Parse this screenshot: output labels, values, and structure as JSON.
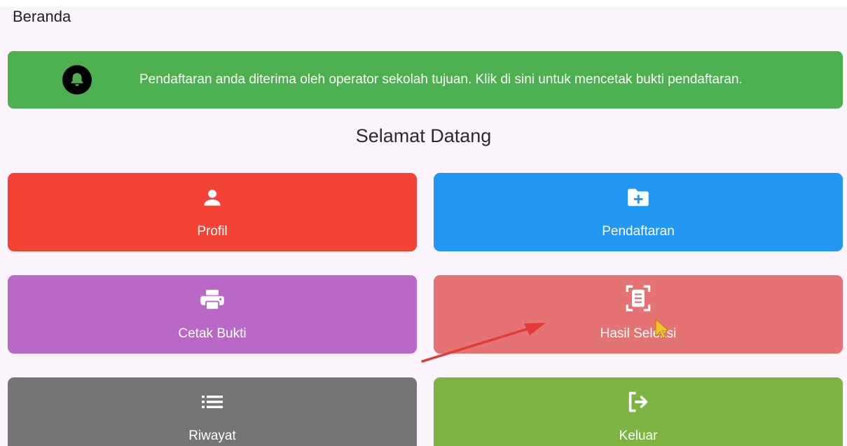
{
  "header": {
    "title": "Beranda"
  },
  "notification": {
    "text": "Pendaftaran anda diterima oleh operator sekolah tujuan. Klik di sini untuk mencetak bukti pendaftaran.",
    "icon": "bell-icon",
    "color": "#4caf50"
  },
  "welcome": {
    "text": "Selamat Datang"
  },
  "menu": {
    "tiles": [
      {
        "label": "Profil",
        "icon": "user-icon",
        "color": "#f44336"
      },
      {
        "label": "Pendaftaran",
        "icon": "folder-plus-icon",
        "color": "#2196f3"
      },
      {
        "label": "Cetak Bukti",
        "icon": "printer-icon",
        "color": "#b968c7"
      },
      {
        "label": "Hasil Seleksi",
        "icon": "document-scan-icon",
        "color": "#e57373"
      },
      {
        "label": "Riwayat",
        "icon": "list-icon",
        "color": "#757575"
      },
      {
        "label": "Keluar",
        "icon": "logout-icon",
        "color": "#7cb342"
      }
    ]
  },
  "annotation": {
    "arrow_color": "#e53935"
  }
}
